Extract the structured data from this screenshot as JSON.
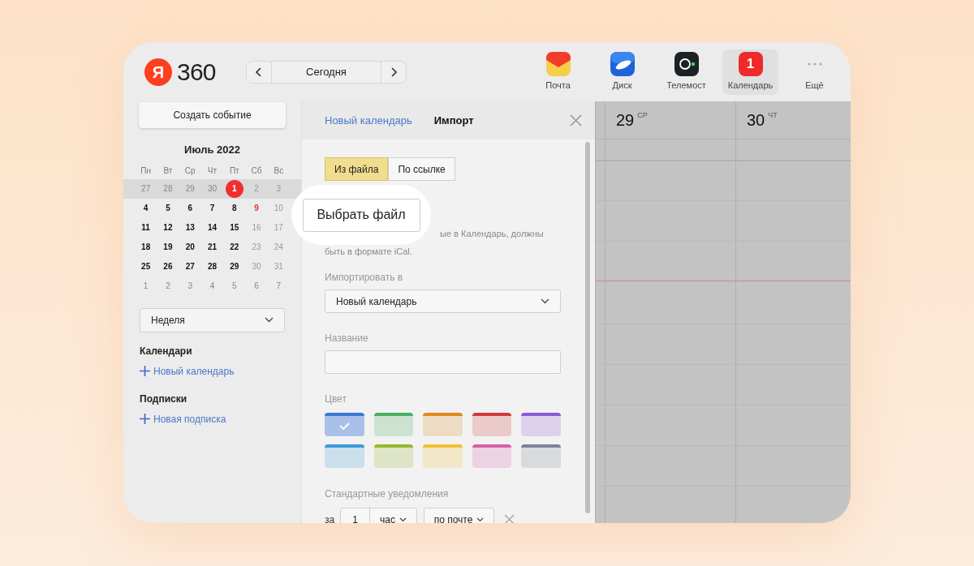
{
  "header": {
    "logo": {
      "mark": "Я",
      "text": "360"
    },
    "today_button": "Сегодня"
  },
  "apps": [
    {
      "kind": "mail",
      "label": "Почта",
      "selected": false
    },
    {
      "kind": "disk",
      "label": "Диск",
      "selected": false
    },
    {
      "kind": "telemost",
      "label": "Телемост",
      "selected": false
    },
    {
      "kind": "calendar",
      "label": "Календарь",
      "selected": true,
      "badge": "1"
    },
    {
      "kind": "more",
      "label": "Ещё",
      "selected": false
    }
  ],
  "sidebar": {
    "create_button": "Создать событие",
    "month": "Июль 2022",
    "weekdays": [
      "Пн",
      "Вт",
      "Ср",
      "Чт",
      "Пт",
      "Сб",
      "Вс"
    ],
    "weeks": [
      {
        "current": true,
        "days": [
          {
            "label": "27",
            "kind": "muted"
          },
          {
            "label": "28",
            "kind": "muted"
          },
          {
            "label": "29",
            "kind": "muted"
          },
          {
            "label": "30",
            "kind": "muted"
          },
          {
            "label": "1",
            "kind": "today"
          },
          {
            "label": "2",
            "kind": "weekend"
          },
          {
            "label": "3",
            "kind": "weekend"
          }
        ]
      },
      {
        "current": false,
        "days": [
          {
            "label": "4",
            "kind": "normal"
          },
          {
            "label": "5",
            "kind": "normal"
          },
          {
            "label": "6",
            "kind": "normal"
          },
          {
            "label": "7",
            "kind": "normal"
          },
          {
            "label": "8",
            "kind": "normal"
          },
          {
            "label": "9",
            "kind": "holiday"
          },
          {
            "label": "10",
            "kind": "weekend"
          }
        ]
      },
      {
        "current": false,
        "days": [
          {
            "label": "11",
            "kind": "normal"
          },
          {
            "label": "12",
            "kind": "normal"
          },
          {
            "label": "13",
            "kind": "normal"
          },
          {
            "label": "14",
            "kind": "normal"
          },
          {
            "label": "15",
            "kind": "normal"
          },
          {
            "label": "16",
            "kind": "weekend"
          },
          {
            "label": "17",
            "kind": "weekend"
          }
        ]
      },
      {
        "current": false,
        "days": [
          {
            "label": "18",
            "kind": "normal"
          },
          {
            "label": "19",
            "kind": "normal"
          },
          {
            "label": "20",
            "kind": "normal"
          },
          {
            "label": "21",
            "kind": "normal"
          },
          {
            "label": "22",
            "kind": "normal"
          },
          {
            "label": "23",
            "kind": "weekend"
          },
          {
            "label": "24",
            "kind": "weekend"
          }
        ]
      },
      {
        "current": false,
        "days": [
          {
            "label": "25",
            "kind": "normal"
          },
          {
            "label": "26",
            "kind": "normal"
          },
          {
            "label": "27",
            "kind": "normal"
          },
          {
            "label": "28",
            "kind": "normal"
          },
          {
            "label": "29",
            "kind": "normal"
          },
          {
            "label": "30",
            "kind": "weekend"
          },
          {
            "label": "31",
            "kind": "weekend"
          }
        ]
      },
      {
        "current": false,
        "days": [
          {
            "label": "1",
            "kind": "muted"
          },
          {
            "label": "2",
            "kind": "muted"
          },
          {
            "label": "3",
            "kind": "muted"
          },
          {
            "label": "4",
            "kind": "muted"
          },
          {
            "label": "5",
            "kind": "muted"
          },
          {
            "label": "6",
            "kind": "muted"
          },
          {
            "label": "7",
            "kind": "muted"
          }
        ]
      }
    ],
    "view_select": "Неделя",
    "sections": [
      {
        "title": "Календари",
        "action": "Новый календарь"
      },
      {
        "title": "Подписки",
        "action": "Новая подписка"
      }
    ]
  },
  "dialog": {
    "tabs": [
      {
        "label": "Новый календарь",
        "selected": false
      },
      {
        "label": "Импорт",
        "selected": true
      }
    ],
    "source_options": [
      {
        "label": "Из файла",
        "selected": true
      },
      {
        "label": "По ссылке",
        "selected": false
      }
    ],
    "choose_file_button": "Выбрать файл",
    "hint_lines": [
      "ые в Календарь, должны",
      "быть в формате iCal."
    ],
    "import_to": {
      "label": "Импортировать в",
      "value": "Новый календарь"
    },
    "name": {
      "label": "Название"
    },
    "color": {
      "label": "Цвет",
      "swatches": [
        {
          "color": "#3b78d8",
          "selected": true
        },
        {
          "color": "#4caf60",
          "selected": false
        },
        {
          "color": "#e08a1e",
          "selected": false
        },
        {
          "color": "#d03c3c",
          "selected": false
        },
        {
          "color": "#8a5ad8",
          "selected": false
        },
        {
          "color": "#3c9ad8",
          "selected": false
        },
        {
          "color": "#96b928",
          "selected": false
        },
        {
          "color": "#f0c030",
          "selected": false
        },
        {
          "color": "#d860a8",
          "selected": false
        },
        {
          "color": "#7c8498",
          "selected": false
        }
      ]
    },
    "notifications": {
      "label": "Стандартные уведомления",
      "prefix": "за",
      "amount": "1",
      "unit": "час",
      "channel": "по почте"
    }
  },
  "week_view": {
    "days": [
      {
        "number": "29",
        "weekday": "СР"
      },
      {
        "number": "30",
        "weekday": "ЧТ"
      }
    ]
  }
}
